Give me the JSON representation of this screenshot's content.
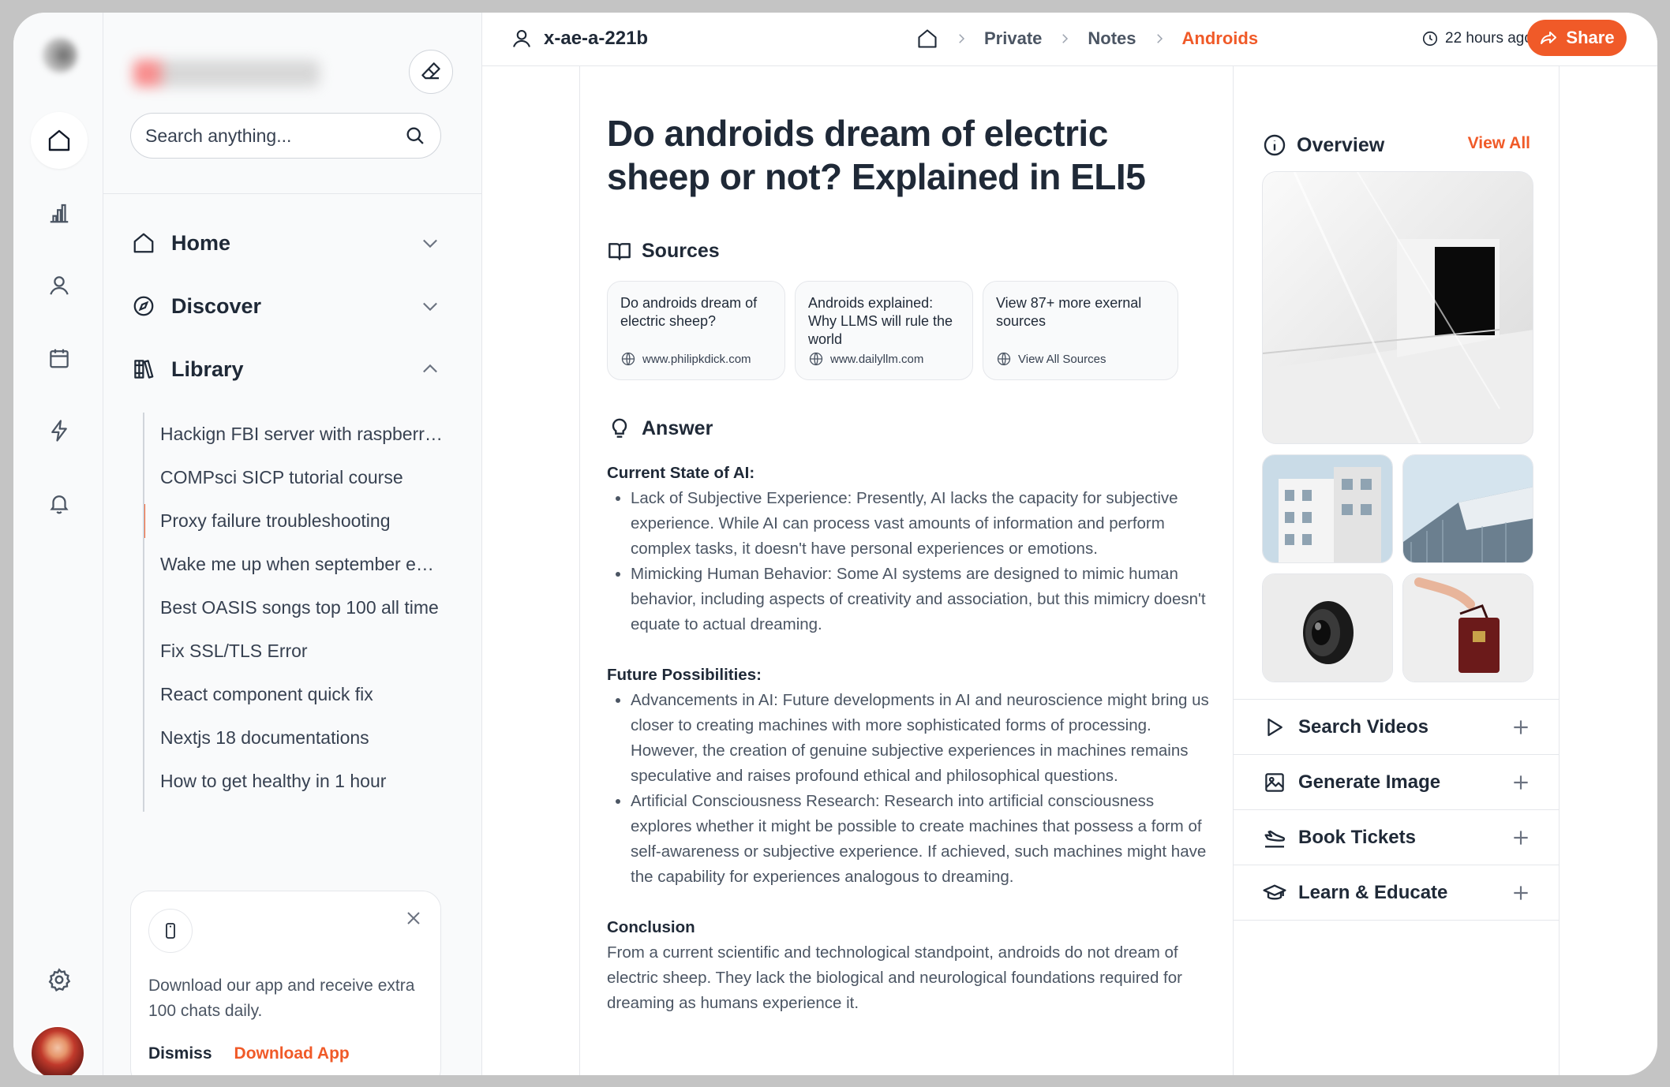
{
  "sidebar": {
    "search_placeholder": "Search anything...",
    "nav": [
      {
        "label": "Home"
      },
      {
        "label": "Discover"
      },
      {
        "label": "Library"
      }
    ],
    "library_items": [
      "Hackign FBI server with raspberry pi",
      "COMPsci SICP tutorial course",
      "Proxy failure troubleshooting",
      "Wake me up when september ends",
      "Best OASIS songs top 100 all time",
      "Fix SSL/TLS Error",
      "React component quick fix",
      "Nextjs 18 documentations",
      "How to get healthy in 1 hour"
    ],
    "active_library_index": 2,
    "promo": {
      "text": "Download our app and receive extra 100 chats daily.",
      "dismiss": "Dismiss",
      "download": "Download App"
    }
  },
  "topbar": {
    "user_id": "x-ae-a-221b",
    "breadcrumb": [
      "Private",
      "Notes",
      "Androids"
    ],
    "time": "22 hours ago",
    "share": "Share"
  },
  "article": {
    "title": "Do androids dream of electric sheep or not? Explained in ELI5",
    "sources_heading": "Sources",
    "sources": [
      {
        "title": "Do androids dream of electric sheep?",
        "url": "www.philipkdick.com"
      },
      {
        "title": "Androids explained: Why LLMS will rule the world",
        "url": "www.dailyllm.com"
      },
      {
        "title": "View 87+ more exernal sources",
        "url": "View All Sources"
      }
    ],
    "answer_heading": "Answer",
    "sections": [
      {
        "heading": "Current State of AI:",
        "bullets": [
          "Lack of Subjective Experience: Presently, AI lacks the capacity for subjective experience. While AI can process vast amounts of information and perform complex tasks, it doesn't have personal experiences or emotions.",
          "Mimicking Human Behavior: Some AI systems are designed to mimic human behavior, including aspects of creativity and association, but this mimicry doesn't equate to actual dreaming."
        ]
      },
      {
        "heading": "Future Possibilities:",
        "bullets": [
          "Advancements in AI: Future developments in AI and neuroscience might bring us closer to creating machines with more sophisticated forms of processing. However, the creation of genuine subjective experiences in machines remains speculative and raises profound ethical and philosophical questions.",
          "Artificial Consciousness Research: Research into artificial consciousness explores whether it might be possible to create machines that possess a form of self-awareness or subjective experience. If achieved, such machines might have the capability for experiences analogous to dreaming."
        ]
      }
    ],
    "conclusion_heading": "Conclusion",
    "conclusion": "From a current scientific and technological standpoint, androids do not dream of electric sheep. They lack the biological and neurological foundations required for dreaming as humans experience it."
  },
  "overview": {
    "heading": "Overview",
    "view_all": "View All",
    "actions": [
      {
        "label": "Search Videos",
        "icon": "play-icon"
      },
      {
        "label": "Generate Image",
        "icon": "image-icon"
      },
      {
        "label": "Book Tickets",
        "icon": "plane-icon"
      },
      {
        "label": "Learn & Educate",
        "icon": "graduation-cap-icon"
      }
    ]
  },
  "colors": {
    "accent": "#f05a28",
    "text": "#1f2937",
    "muted": "#4b5563",
    "border": "#e5e7eb",
    "sidebar_bg": "#f9fafb"
  }
}
